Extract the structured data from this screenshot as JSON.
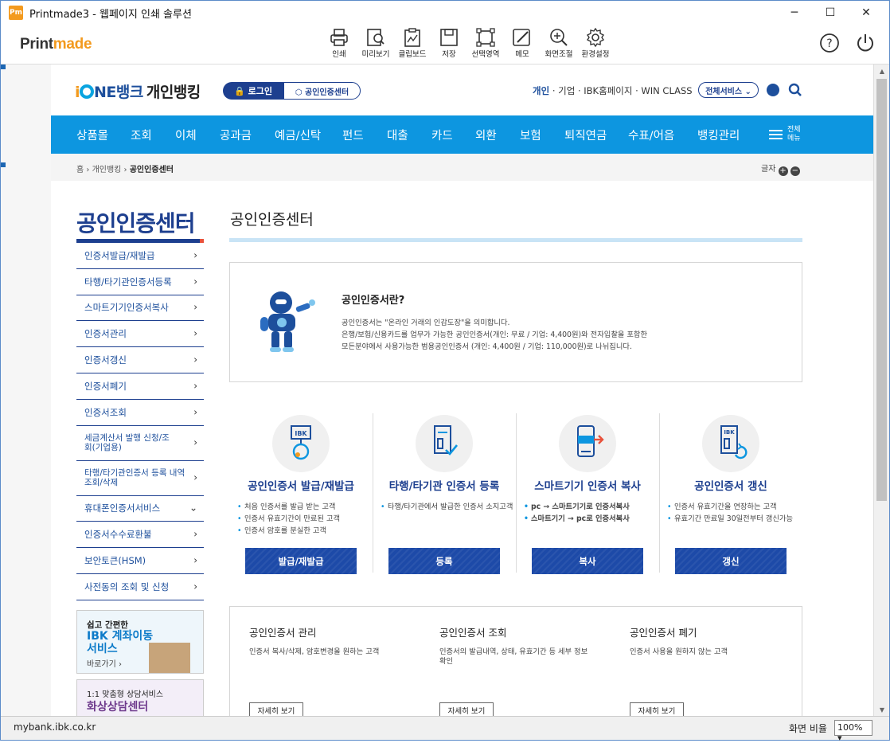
{
  "window": {
    "title": "Printmade3 - 웹페이지 인쇄 솔루션",
    "app_icon_text": "Pm",
    "minimize": "─",
    "maximize": "☐",
    "close": "✕"
  },
  "toolbar": {
    "logo_print": "Print",
    "logo_made": "made",
    "tools": [
      {
        "label": "인쇄",
        "icon": "printer-icon"
      },
      {
        "label": "미리보기",
        "icon": "preview-icon"
      },
      {
        "label": "클립보드",
        "icon": "clipboard-icon"
      },
      {
        "label": "저장",
        "icon": "save-icon"
      },
      {
        "label": "선택영역",
        "icon": "select-area-icon"
      },
      {
        "label": "메모",
        "icon": "memo-pen-icon"
      },
      {
        "label": "화면조절",
        "icon": "zoom-icon"
      },
      {
        "label": "환경설정",
        "icon": "gear-icon"
      }
    ],
    "help": "help-icon",
    "power": "power-icon"
  },
  "site": {
    "brand_i": "i",
    "brand_rest": "NE뱅크",
    "brand_sub": "개인뱅킹",
    "login": "🔒 로그인",
    "cert_center": "⬡ 공인인증센터",
    "toplinks": {
      "personal": "개인",
      "corp": "기업",
      "ibk_home": "IBK홈페이지",
      "winclass": "WIN CLASS",
      "sep": " · "
    },
    "all_services": "전체서비스 ⌄",
    "gnb": [
      "상품몰",
      "조회",
      "이체",
      "공과금",
      "예금/신탁",
      "펀드",
      "대출",
      "카드",
      "외환",
      "보험",
      "퇴직연금",
      "수표/어음",
      "뱅킹관리"
    ],
    "all_menu": "전체 메뉴",
    "breadcrumb": {
      "home": "홈",
      "sep": " › ",
      "l1": "개인뱅킹",
      "l2": "공인인증센터"
    },
    "font_label": "글자",
    "font_plus": "+",
    "font_minus": "−"
  },
  "lnb": {
    "title": "공인인증센터",
    "items": [
      {
        "label": "인증서발급/재발급",
        "chev": "›"
      },
      {
        "label": "타행/타기관인증서등록",
        "chev": "›"
      },
      {
        "label": "스마트기기인증서복사",
        "chev": "›"
      },
      {
        "label": "인증서관리",
        "chev": "›"
      },
      {
        "label": "인증서갱신",
        "chev": "›"
      },
      {
        "label": "인증서폐기",
        "chev": "›"
      },
      {
        "label": "인증서조회",
        "chev": "›"
      },
      {
        "label": "세금계산서 발행 신청/조회(기업용)",
        "chev": "›"
      },
      {
        "label": "타행/타기관인증서 등록 내역조회/삭제",
        "chev": "›"
      },
      {
        "label": "휴대폰인증서서비스",
        "chev": "⌄"
      },
      {
        "label": "인증서수수료환불",
        "chev": "›"
      },
      {
        "label": "보안토큰(HSM)",
        "chev": "›"
      },
      {
        "label": "사전동의 조회 및 신청",
        "chev": "›"
      }
    ],
    "banner1": {
      "a": "쉽고 간편한",
      "b": "IBK 계좌이동 서비스",
      "c": "바로가기 ›"
    },
    "banner2": {
      "a": "1:1 맞춤형 상담서비스",
      "b": "화상상담센터"
    }
  },
  "main": {
    "title": "공인인증센터",
    "intro_head": "공인인증서란?",
    "intro_lines": [
      "공인인증서는 \"온라인 거래의 인감도장\"을 의미합니다.",
      "은행/보험/신용카드를 업무가 가능한 공인인증서(개인: 무료 / 기업: 4,400원)와 전자입찰을 포함한",
      "모든분야에서 사용가능한 범용공인인증서 (개인: 4,400원 / 기업: 110,000원)로 나뉘집니다."
    ],
    "services": [
      {
        "title": "공인인증서 발급/재발급",
        "items": [
          "처음 인증서를 발급 받는 고객",
          "인증서 유효기간이 만료된 고객",
          "인증서 암호를 분실한 고객"
        ],
        "button": "발급/재발급"
      },
      {
        "title": "타행/타기관 인증서 등록",
        "items": [
          "타행/타기관에서 발급한 인증서 소지고객"
        ],
        "button": "등록"
      },
      {
        "title": "스마트기기 인증서 복사",
        "items": [
          "pc → 스마트기기로 인증서복사",
          "스마트기기 → pc로 인증서복사"
        ],
        "button": "복사"
      },
      {
        "title": "공인인증서 갱신",
        "items": [
          "인증서 유효기간을 연장하는 고객",
          "유효기간 만료일 30일전부터 갱신가능"
        ],
        "button": "갱신"
      }
    ],
    "bottom": [
      {
        "title": "공인인증서 관리",
        "desc": "인증서 복사/삭제, 암호변경을 원하는 고객",
        "more": "자세히 보기"
      },
      {
        "title": "공인인증서 조회",
        "desc": "인증서의 발급내역, 상태, 유효기간 등 세부 정보 확인",
        "more": "자세히 보기"
      },
      {
        "title": "공인인증서 폐기",
        "desc": "인증서 사용을 원하지 않는 고객",
        "more": "자세히 보기"
      }
    ]
  },
  "status": {
    "url": "mybank.ibk.co.kr",
    "zoom_label": "화면 비율",
    "zoom_value": "100% ▾"
  },
  "colors": {
    "brand_blue": "#1d3f8f",
    "gnb_blue": "#0d96e0",
    "accent_orange": "#f39a1e"
  }
}
